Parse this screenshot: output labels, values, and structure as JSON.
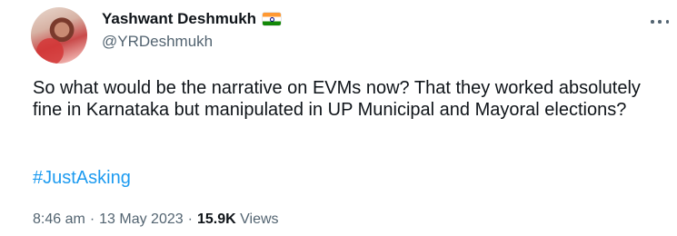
{
  "author": {
    "display_name": "Yashwant Deshmukh",
    "handle": "@YRDeshmukh",
    "flag_icon": "india-flag-icon"
  },
  "tweet": {
    "text": "So what would be the narrative on EVMs now? That they worked absolutely fine in Karnataka but manipulated in UP Municipal and Mayoral elections?",
    "hashtag": "#JustAsking"
  },
  "meta": {
    "time": "8:46 am",
    "separator": "·",
    "date": "13 May 2023",
    "views_count": "15.9K",
    "views_label": "Views"
  },
  "colors": {
    "text": "#0f1419",
    "secondary": "#536471",
    "link": "#1d9bf0"
  }
}
